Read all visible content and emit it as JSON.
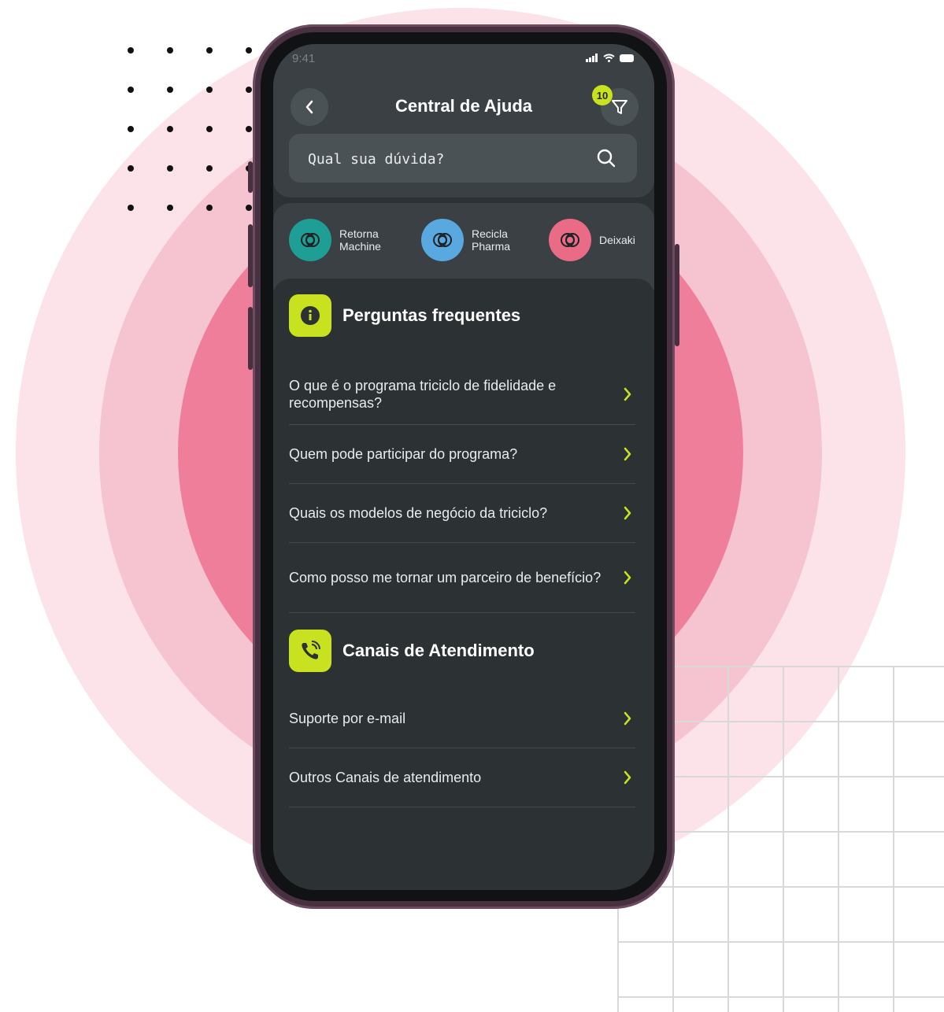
{
  "status_bar": {
    "time": "9:41"
  },
  "header": {
    "title": "Central de Ajuda",
    "filter_count": "10",
    "search_placeholder": "Qual sua dúvida?"
  },
  "brands": [
    {
      "label": "Retorna\nMachine",
      "color": "#1f9e96"
    },
    {
      "label": "Recicla\nPharma",
      "color": "#5aa8e0"
    },
    {
      "label": "Deixaki",
      "color": "#e96b86"
    }
  ],
  "faq": {
    "title": "Perguntas frequentes",
    "items": [
      "O que é o programa triciclo de fidelidade e recompensas?",
      "Quem pode participar do programa?",
      "Quais os modelos de negócio da triciclo?",
      "Como posso me tornar um parceiro de benefício?"
    ]
  },
  "support": {
    "title": "Canais de Atendimento",
    "items": [
      "Suporte por e-mail",
      "Outros Canais de atendimento"
    ]
  },
  "colors": {
    "accent": "#c9e21f",
    "screen_bg": "#2c3134",
    "header_bg": "#3a4044",
    "phone_frame": "#47303f"
  },
  "icons": {
    "back": "chevron-left-icon",
    "filter": "filter-icon",
    "search": "search-icon",
    "info": "info-icon",
    "phone": "phone-icon",
    "row": "chevron-right-icon"
  }
}
